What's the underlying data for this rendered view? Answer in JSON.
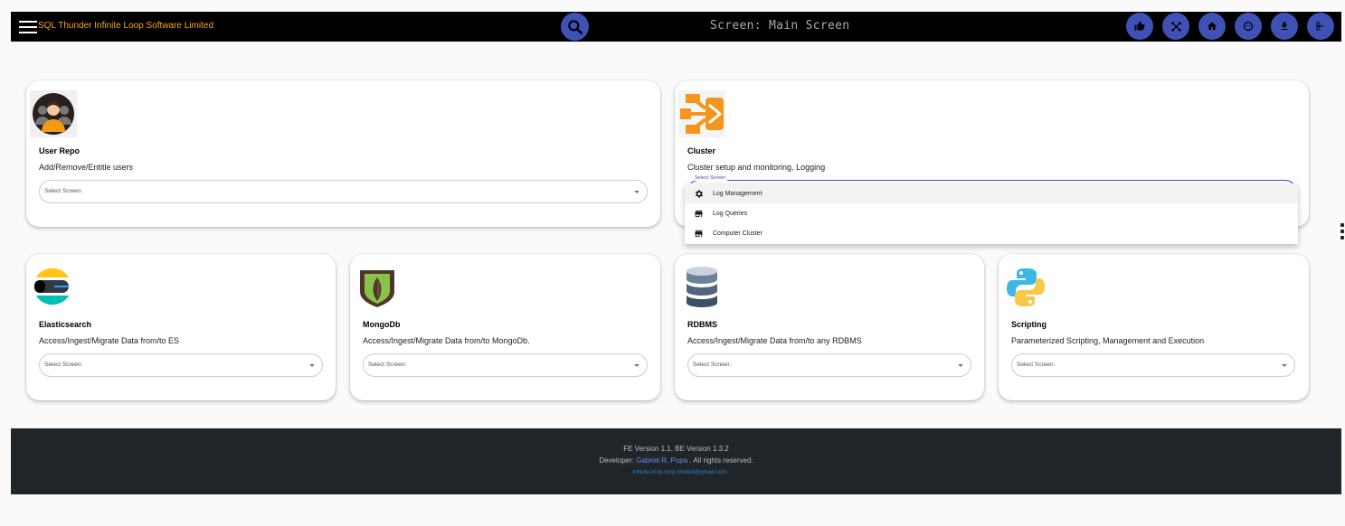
{
  "header": {
    "app_title": "SQL Thunder Infinite Loop Software Limited",
    "screen_label": "Screen:  Main Screen",
    "accent_color": "#3f51b5",
    "title_color": "#f5a623",
    "icons": [
      "search-icon",
      "thumbs-up-icon",
      "cluster-icon",
      "home-icon",
      "face-icon",
      "download-icon",
      "logout-icon"
    ]
  },
  "cards": [
    {
      "title": "User Repo",
      "description": "Add/Remove/Entitle users",
      "select_placeholder": "Select Screen:"
    },
    {
      "title": "Cluster",
      "description": "Cluster setup and monitoring, Logging",
      "select_placeholder": "Select Screen"
    },
    {
      "title": "Elasticsearch",
      "description": "Access/Ingest/Migrate Data from/to ES",
      "select_placeholder": "Select Screen:"
    },
    {
      "title": "MongoDb",
      "description": "Access/Ingest/Migrate Data from/to MongoDb.",
      "select_placeholder": "Select Screen:"
    },
    {
      "title": "RDBMS",
      "description": "Access/Ingest/Migrate Data from/to any RDBMS",
      "select_placeholder": "Select Screen:"
    },
    {
      "title": "Scripting",
      "description": "Parameterized Scripting, Management and Execution",
      "select_placeholder": "Select Screen:"
    }
  ],
  "dropdown": {
    "options": [
      {
        "label": "Log Management",
        "icon": "gear-icon"
      },
      {
        "label": "Log Queries",
        "icon": "store-icon"
      },
      {
        "label": "Computer Cluster",
        "icon": "store-icon"
      }
    ]
  },
  "footer": {
    "version": "FE Version 1.1, BE Version 1.3.2",
    "developer_prefix": "Developer:",
    "developer_name": "Gabriel R. Popa",
    "rights": ". All rights reserved.",
    "email": "infinite.loop.corp.limited@gmail.com"
  }
}
